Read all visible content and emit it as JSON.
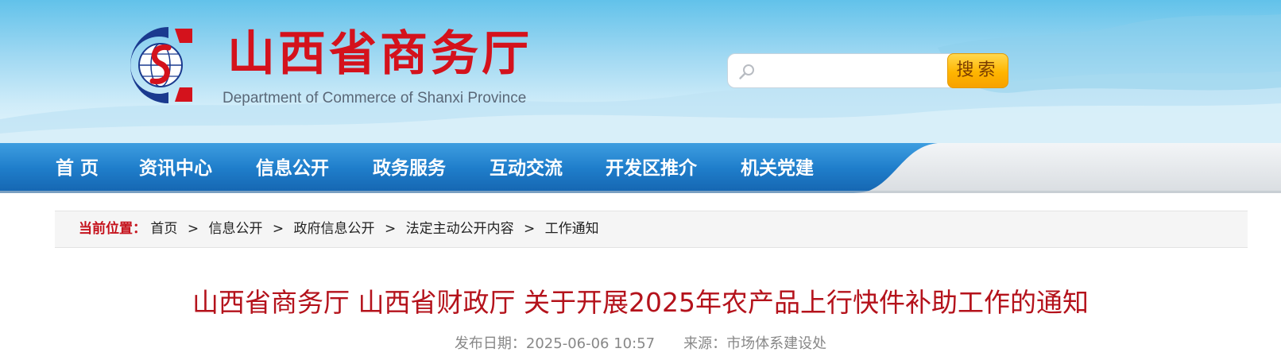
{
  "header": {
    "site_title": "山西省商务厅",
    "site_subtitle": "Department of Commerce of Shanxi Province",
    "logo_icon": "shanxi-commerce-logo-icon",
    "colors": {
      "brand_red": "#d4121c",
      "brand_blue": "#1a3a8f",
      "nav_blue": "#1e78c3",
      "search_orange": "#ffb500"
    }
  },
  "search": {
    "placeholder": "",
    "value": "",
    "button_label": "搜索",
    "icon": "search-icon"
  },
  "nav": {
    "items": [
      {
        "label": "首  页"
      },
      {
        "label": "资讯中心"
      },
      {
        "label": "信息公开"
      },
      {
        "label": "政务服务"
      },
      {
        "label": "互动交流"
      },
      {
        "label": "开发区推介"
      },
      {
        "label": "机关党建"
      }
    ]
  },
  "breadcrumb": {
    "lead": "当前位置：",
    "items": [
      "首页",
      "信息公开",
      "政府信息公开",
      "法定主动公开内容",
      "工作通知"
    ],
    "separator": ">"
  },
  "article": {
    "title": "山西省商务厅 山西省财政厅 关于开展2025年农产品上行快件补助工作的通知",
    "date_label": "发布日期：",
    "date_value": "2025-06-06 10:57",
    "source_label": "来源：",
    "source_value": "市场体系建设处"
  }
}
